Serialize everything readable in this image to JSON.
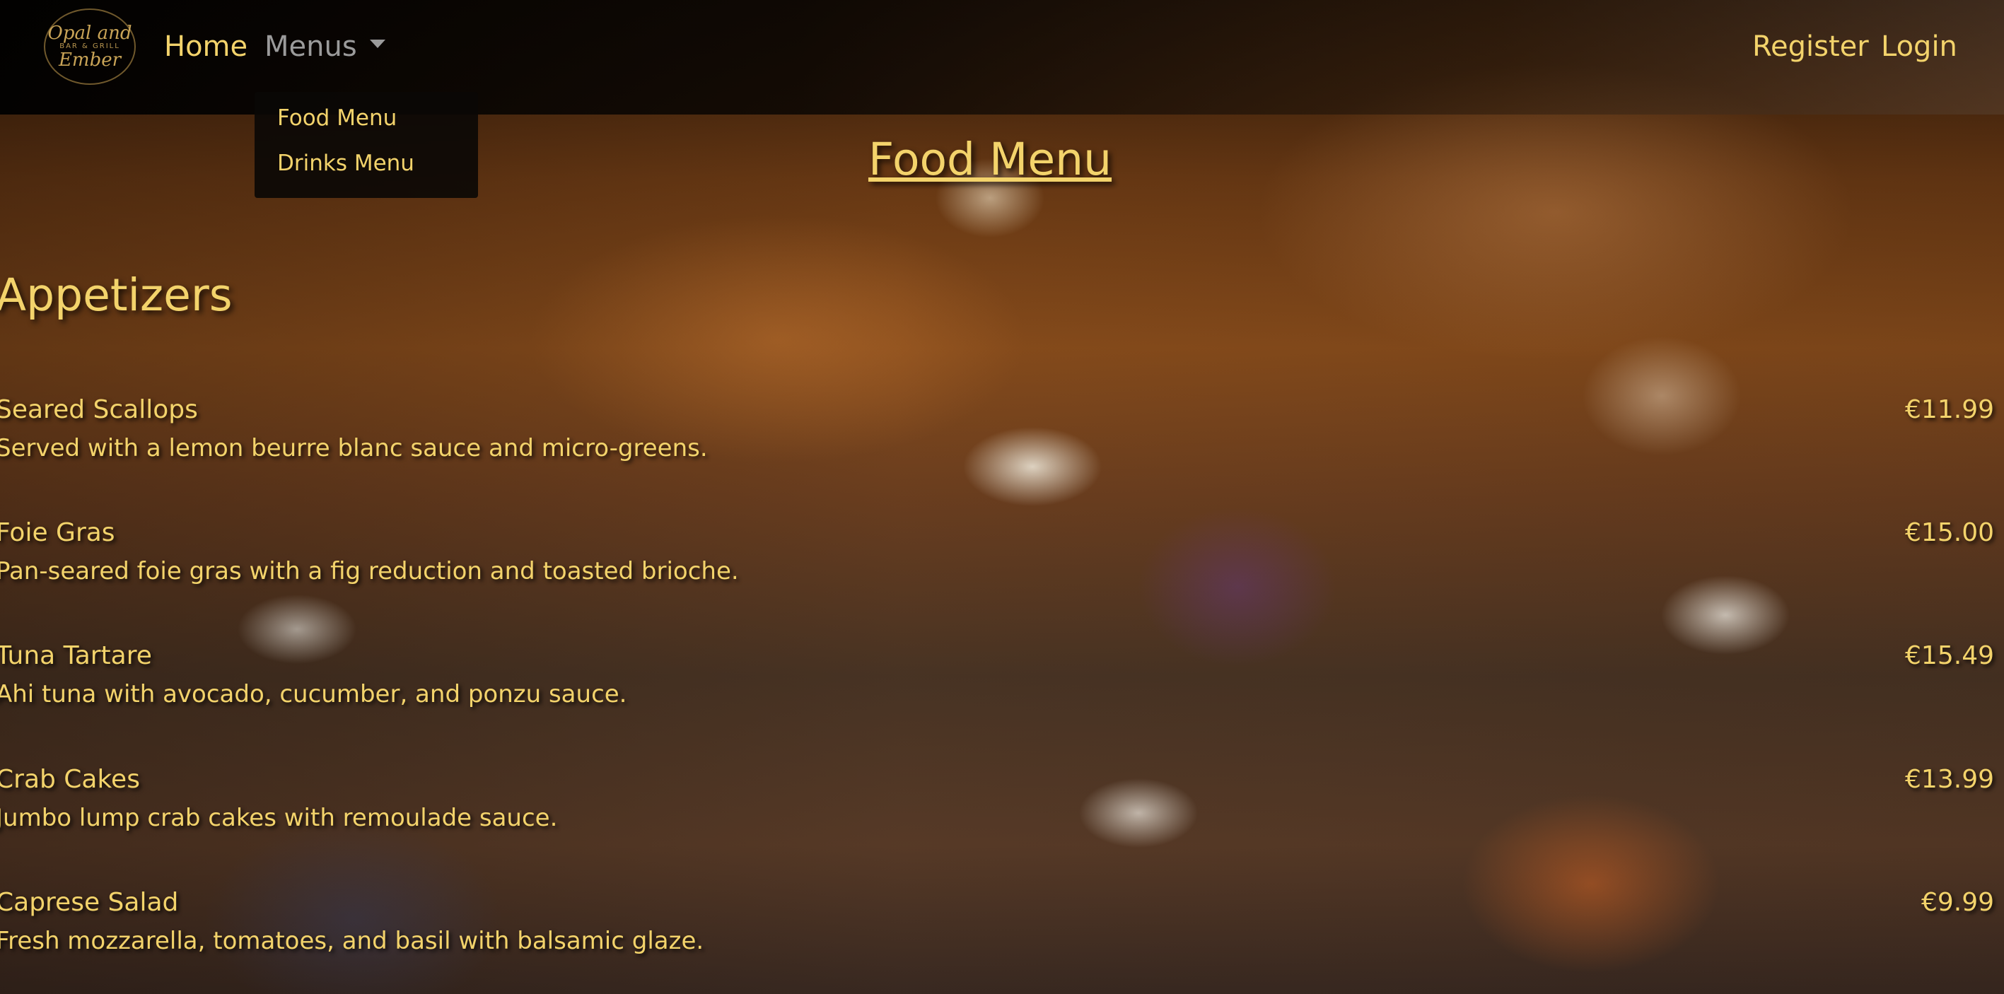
{
  "navbar": {
    "logo": {
      "script_top": "Opal and",
      "small": "BAR & GRILL",
      "script_bottom": "Ember"
    },
    "home": "Home",
    "menus": "Menus",
    "register": "Register",
    "login": "Login"
  },
  "dropdown": {
    "items": [
      {
        "label": "Food Menu"
      },
      {
        "label": "Drinks Menu"
      }
    ]
  },
  "page": {
    "title": "Food Menu"
  },
  "section": {
    "title": "Appetizers",
    "items": [
      {
        "name": "Seared Scallops",
        "description": "Served with a lemon beurre blanc sauce and micro-greens.",
        "price": "€11.99"
      },
      {
        "name": "Foie Gras",
        "description": "Pan-seared foie gras with a fig reduction and toasted brioche.",
        "price": "€15.00"
      },
      {
        "name": "Tuna Tartare",
        "description": "Ahi tuna with avocado, cucumber, and ponzu sauce.",
        "price": "€15.49"
      },
      {
        "name": "Crab Cakes",
        "description": "Jumbo lump crab cakes with remoulade sauce.",
        "price": "€13.99"
      },
      {
        "name": "Caprese Salad",
        "description": "Fresh mozzarella, tomatoes, and basil with balsamic glaze.",
        "price": "€9.99"
      }
    ]
  },
  "colors": {
    "accent": "#f3d36b",
    "muted_nav": "#9b9b9b",
    "navbar_bg": "#000000"
  }
}
